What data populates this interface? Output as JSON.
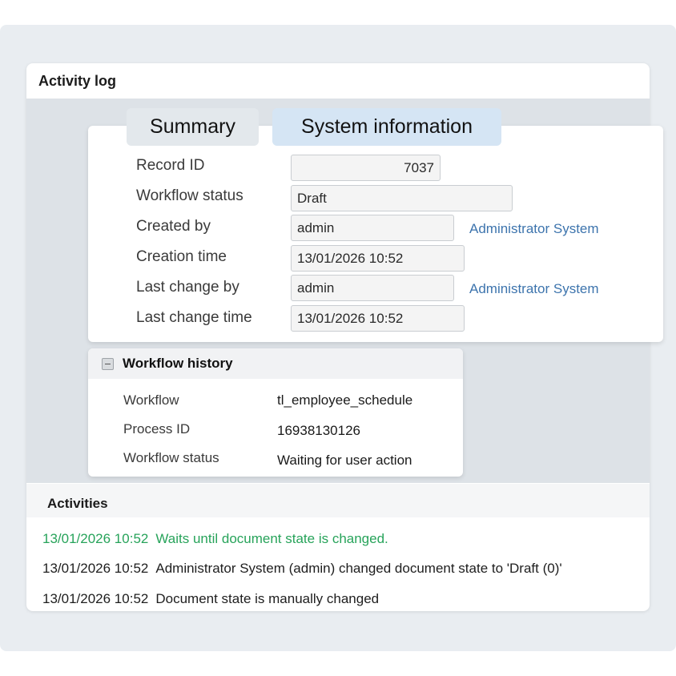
{
  "card": {
    "title": "Activity log"
  },
  "tabs": [
    {
      "label": "Summary"
    },
    {
      "label": "System information",
      "active": true
    }
  ],
  "system_info": {
    "record_id": {
      "label": "Record ID",
      "value": "7037"
    },
    "workflow_status": {
      "label": "Workflow status",
      "value": "Draft"
    },
    "created_by": {
      "label": "Created by",
      "value": "admin",
      "link": "Administrator System"
    },
    "creation_time": {
      "label": "Creation time",
      "value": "13/01/2026 10:52"
    },
    "last_change_by": {
      "label": "Last change by",
      "value": "admin",
      "link": "Administrator System"
    },
    "last_change_time": {
      "label": "Last change time",
      "value": "13/01/2026 10:52"
    }
  },
  "workflow_history": {
    "title": "Workflow history",
    "rows": [
      {
        "label": "Workflow",
        "value": "tl_employee_schedule"
      },
      {
        "label": "Process ID",
        "value": "16938130126"
      },
      {
        "label": "Workflow status",
        "value": "Waiting for user action"
      }
    ]
  },
  "activities": {
    "title": "Activities",
    "items": [
      {
        "time": "13/01/2026 10:52",
        "text": "Waits until document state is changed."
      },
      {
        "time": "13/01/2026 10:52",
        "text": "Administrator System (admin) changed document state to 'Draft (0)'"
      },
      {
        "time": "13/01/2026 10:52",
        "text": "Document state is manually changed"
      }
    ]
  },
  "colors": {
    "link": "#3d74ad",
    "pending_activity": "#27a35a",
    "active_tab": "#d5e5f4"
  },
  "icons": {
    "collapse": "collapse-minus-icon"
  }
}
